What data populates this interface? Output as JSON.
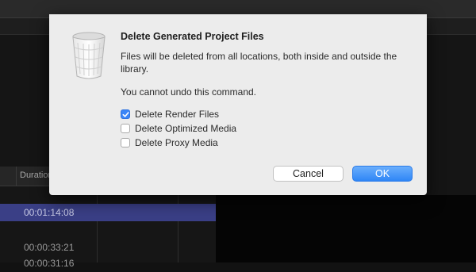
{
  "dialog": {
    "title": "Delete Generated Project Files",
    "message": "Files will be deleted from all locations, both inside and outside the library.",
    "warning": "You cannot undo this command.",
    "options": [
      {
        "label": "Delete Render Files",
        "checked": true
      },
      {
        "label": "Delete Optimized Media",
        "checked": false
      },
      {
        "label": "Delete Proxy Media",
        "checked": false
      }
    ],
    "cancel_label": "Cancel",
    "ok_label": "OK",
    "icon": "trash-icon"
  },
  "browser": {
    "column_header": "Duration",
    "rows": [
      "00:01:14:08",
      "00:00:33:21",
      "00:00:31:16"
    ],
    "selected_row": 0
  },
  "colors": {
    "accent": "#3b86f7",
    "selection": "#3a3f86"
  }
}
